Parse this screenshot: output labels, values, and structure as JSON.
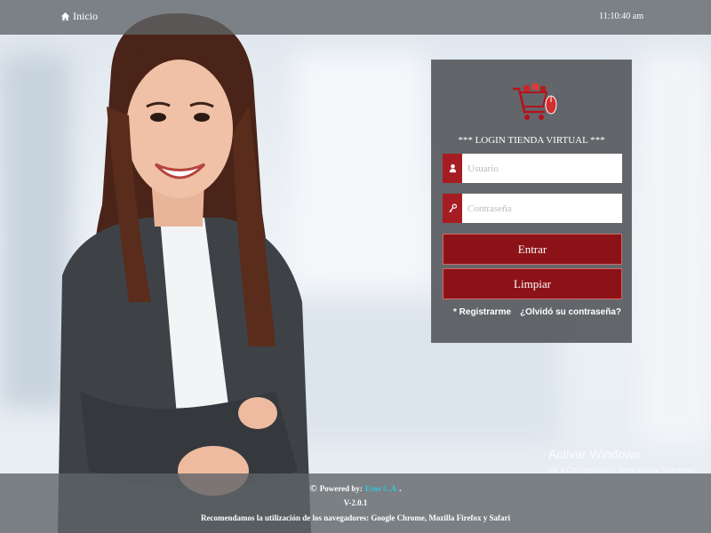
{
  "topbar": {
    "home_label": "Inicio",
    "clock": "11:10:40 am"
  },
  "login": {
    "title": "*** LOGIN TIENDA VIRTUAL ***",
    "username_placeholder": "Usuario",
    "password_placeholder": "Contraseña",
    "submit_label": "Entrar",
    "clear_label": "Limpiar",
    "register_link": "* Registrarme",
    "forgot_link": "¿Olvidó su contraseña?"
  },
  "watermark": {
    "title": "Activar Windows",
    "subtitle": "Ve a Configuración para activar Windows."
  },
  "footer": {
    "copyright_symbol": "©",
    "powered_by": "Powered by:",
    "company": "Eros C.A",
    "period": ".",
    "version": "V-2.0.1",
    "recommendation": "Recomendamos la utilización de los navegadores: Google Chrome, Mozilla Firefox y Safari"
  },
  "colors": {
    "accent": "#8d1218",
    "addon": "#a51d23",
    "company_link": "#2ec6d8"
  },
  "icons": [
    "home-icon",
    "user-icon",
    "key-icon",
    "cart-logo-icon"
  ]
}
